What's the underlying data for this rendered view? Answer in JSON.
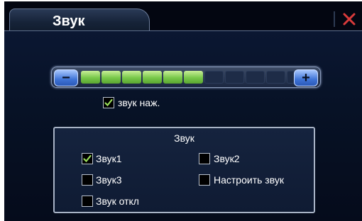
{
  "window": {
    "tab_title": "Звук",
    "close_icon": "close-icon",
    "accent_close": "#d93b3b"
  },
  "volume": {
    "minus_symbol": "−",
    "plus_symbol": "+",
    "level": 6,
    "max": 11
  },
  "key_sound": {
    "label": "звук наж.",
    "checked": true
  },
  "sound_panel": {
    "title": "Звук",
    "options": [
      {
        "label": "Звук1",
        "checked": true
      },
      {
        "label": "Звук2",
        "checked": false
      },
      {
        "label": "Звук3",
        "checked": false
      },
      {
        "label": "Настроить звук",
        "checked": false
      },
      {
        "label": "Звук откл",
        "checked": false
      }
    ]
  }
}
